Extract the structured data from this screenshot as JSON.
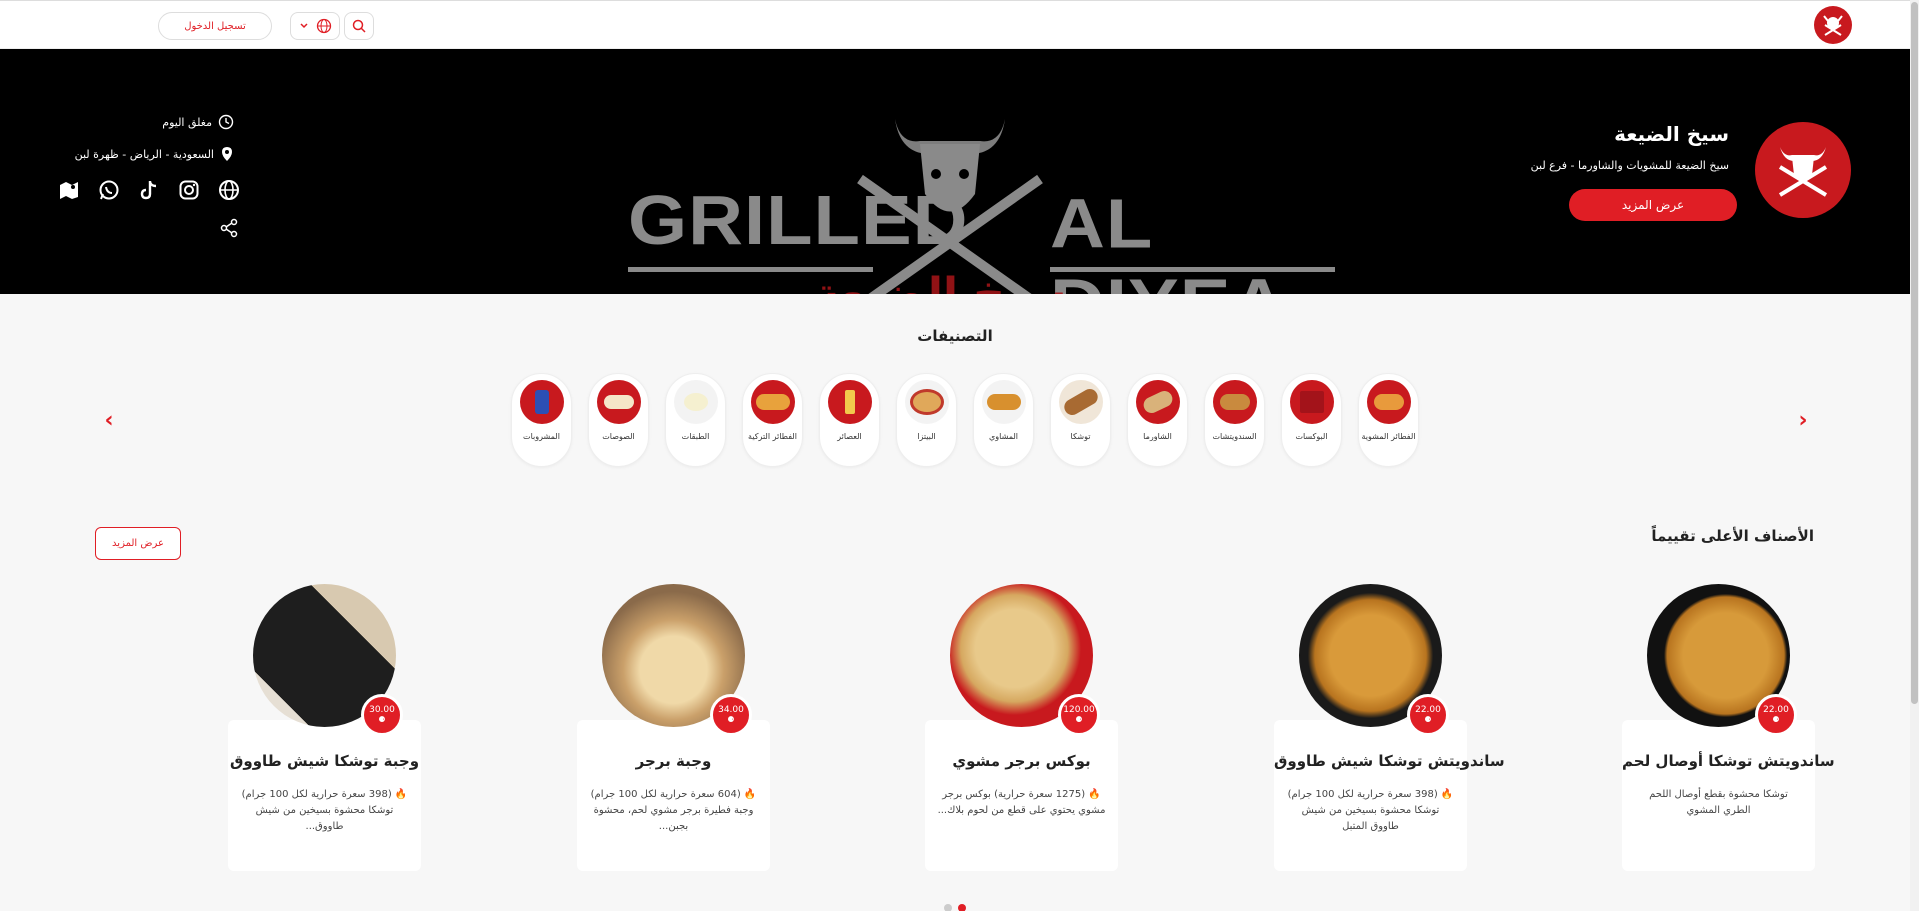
{
  "header": {
    "login_label": "تسجيل الدخول",
    "icons": [
      "bull-logo-icon",
      "globe-icon",
      "chevron-down-icon",
      "search-icon"
    ]
  },
  "hero": {
    "banner_word_1": "GRILLED",
    "banner_word_2": "AL DIYEA",
    "banner_arabic": "سيخ الضيعة",
    "brand_name": "سيخ الضيعة",
    "brand_subtitle": "سيخ الضيعة للمشويات والشاورما - فرع لبن",
    "more_label": "عرض المزيد",
    "status": "مغلق اليوم",
    "location": "السعودية - الرياض - ظهرة لبن",
    "social_icons": [
      "map-icon",
      "whatsapp-icon",
      "tiktok-icon",
      "instagram-icon",
      "website-icon"
    ],
    "accent": "#e01e25"
  },
  "categories": {
    "title": "التصنيفات",
    "items": [
      {
        "label": "الفطائر المشوية"
      },
      {
        "label": "البوكسات"
      },
      {
        "label": "السندويتشات"
      },
      {
        "label": "الشاورما"
      },
      {
        "label": "توشكا"
      },
      {
        "label": "المشاوي"
      },
      {
        "label": "البيتزا"
      },
      {
        "label": "العصائر"
      },
      {
        "label": "الفطائر التركية"
      },
      {
        "label": "الطبقات"
      },
      {
        "label": "الصوصات"
      },
      {
        "label": "المشروبات"
      }
    ]
  },
  "top_rated": {
    "title": "الأصناف الأعلى تقييماً",
    "more_label": "عرض المزيد",
    "items": [
      {
        "name": "ساندويتش توشكا أوصال لحم",
        "price": "22.00",
        "desc": "توشكا محشوة بقطع أوصال اللحم الطري المشوي"
      },
      {
        "name": "ساندويتش توشكا شيش طاووق",
        "price": "22.00",
        "desc": "🔥 (398 سعرة حرارية لكل 100 جرام) توشكا محشوة بسيخين من شيش طاووق المتبل"
      },
      {
        "name": "بوكس برجر مشوي",
        "price": "120.00",
        "desc": "🔥 (1275 سعرة حرارية) بوكس برجر مشوي يحتوي على قطع من لحوم بلاك..."
      },
      {
        "name": "وجبة برجر",
        "price": "34.00",
        "desc": "🔥 (604 سعرة حرارية لكل 100 جرام) وجبة فطيرة برجر مشوي لحم، محشوة بجبن..."
      },
      {
        "name": "وجبة توشكا شيش طاووق",
        "price": "30.00",
        "desc": "🔥 (398 سعرة حرارية لكل 100 جرام) توشكا محشوة بسيخين من شيش طاووق..."
      }
    ]
  }
}
